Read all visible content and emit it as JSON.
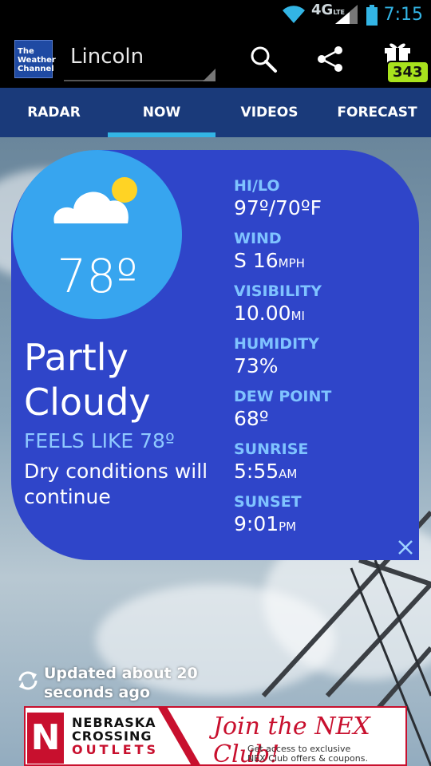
{
  "status_bar": {
    "time": "7:15",
    "network": "4G",
    "network_sub": "LTE"
  },
  "app_bar": {
    "logo": [
      "The",
      "Weather",
      "Channel"
    ],
    "location": "Lincoln",
    "badge_count": "343"
  },
  "tabs": [
    {
      "label": "RADAR",
      "active": false
    },
    {
      "label": "NOW",
      "active": true
    },
    {
      "label": "VIDEOS",
      "active": false
    },
    {
      "label": "FORECAST",
      "active": false
    }
  ],
  "current": {
    "temperature": "78º",
    "condition_line1": "Partly",
    "condition_line2": "Cloudy",
    "feels_like": "FEELS LIKE 78º",
    "description": "Dry conditions will continue",
    "icon": "partly-cloudy-icon"
  },
  "stats": [
    {
      "label": "HI/LO",
      "value": "97º/70ºF",
      "unit": ""
    },
    {
      "label": "WIND",
      "value": "S 16",
      "unit": "MPH"
    },
    {
      "label": "VISIBILITY",
      "value": "10.00",
      "unit": "MI"
    },
    {
      "label": "HUMIDITY",
      "value": "73%",
      "unit": ""
    },
    {
      "label": "DEW POINT",
      "value": "68º",
      "unit": ""
    },
    {
      "label": "SUNRISE",
      "value": "5:55",
      "unit": "AM"
    },
    {
      "label": "SUNSET",
      "value": "9:01",
      "unit": "PM"
    }
  ],
  "updated": "Updated about 20 seconds ago",
  "ad": {
    "logo_letter": "N",
    "brand_line1": "NEBRASKA",
    "brand_line2": "CROSSING",
    "brand_line3": "OUTLETS",
    "headline": "Join the NEX Club!",
    "sub_line1": "Get access to exclusive",
    "sub_line2": "NEX Club offers & coupons."
  },
  "colors": {
    "card": "#2f45c9",
    "circle": "#37a5ef",
    "tab_bar": "#1a3a7a",
    "accent": "#33b5e5",
    "badge": "#a8e21d",
    "label": "#7fc3ff"
  }
}
